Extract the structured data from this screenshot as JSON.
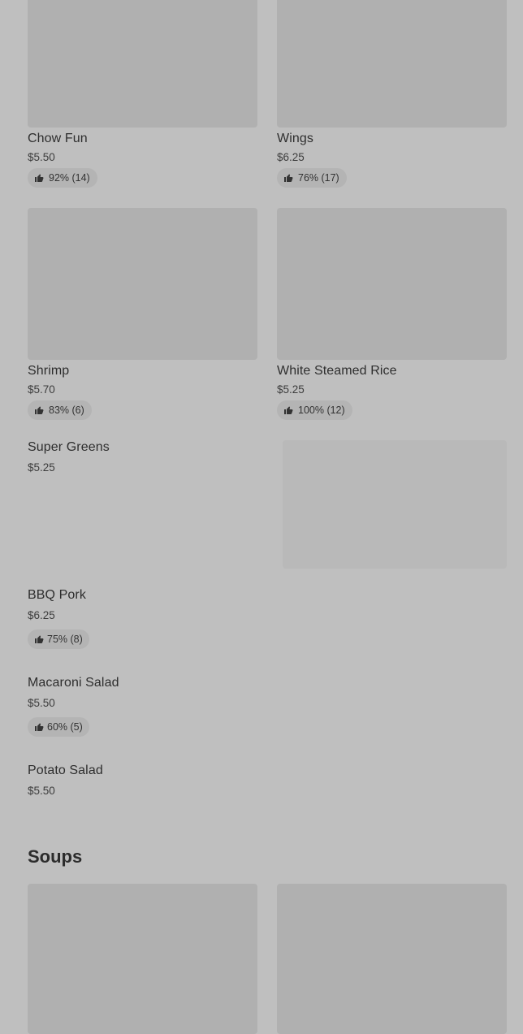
{
  "items": [
    {
      "name": "Chow Fun",
      "price": "$5.50",
      "rating": "92% (14)"
    },
    {
      "name": "Wings",
      "price": "$6.25",
      "rating": "76% (17)"
    },
    {
      "name": "Shrimp",
      "price": "$5.70",
      "rating": "83% (6)"
    },
    {
      "name": "White Steamed Rice",
      "price": "$5.25",
      "rating": "100% (12)"
    },
    {
      "name": "Super Greens",
      "price": "$5.25"
    },
    {
      "name": "BBQ Pork",
      "price": "$6.25",
      "rating": "75% (8)"
    },
    {
      "name": "Macaroni Salad",
      "price": "$5.50",
      "rating": "60% (5)"
    },
    {
      "name": "Potato Salad",
      "price": "$5.50"
    }
  ],
  "sections": {
    "soups_title": "Soups"
  },
  "icons": {
    "rating": "thumbs-up-icon"
  },
  "colors": {
    "background": "#bfbfbf",
    "image_placeholder": "#b0b0b0",
    "rating_pill": "#b4b4b4"
  }
}
